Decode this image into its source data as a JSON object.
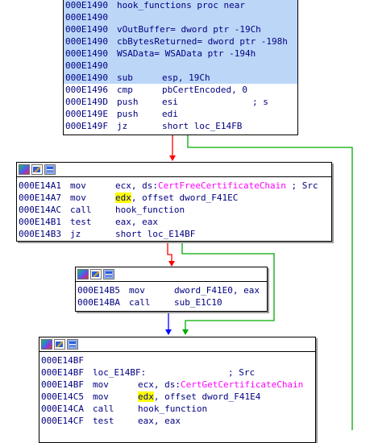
{
  "colors": {
    "edge_false": "#ff0000",
    "edge_true": "#00aa00",
    "edge_uncond": "#0000ff",
    "selection": "#bcd6f8",
    "text": "#000080",
    "api_name": "#ff00ff",
    "register_highlight": "#ffff00"
  },
  "block1": {
    "lines": [
      {
        "addr": "000E1490",
        "mn": "hook_functions proc near",
        "op": "",
        "cm": ""
      },
      {
        "addr": "000E1490",
        "mn": "",
        "op": "",
        "cm": ""
      },
      {
        "addr": "000E1490",
        "mn": "vOutBuffer= dword ptr -19Ch",
        "op": "",
        "cm": ""
      },
      {
        "addr": "000E1490",
        "mn": "cbBytesReturned= dword ptr -198h",
        "op": "",
        "cm": ""
      },
      {
        "addr": "000E1490",
        "mn": "WSAData= WSAData ptr -194h",
        "op": "",
        "cm": ""
      },
      {
        "addr": "000E1490",
        "mn": "",
        "op": "",
        "cm": ""
      },
      {
        "addr": "000E1490",
        "mn": "sub",
        "op": "esp, 19Ch",
        "cm": ""
      },
      {
        "addr": "000E1496",
        "mn": "cmp",
        "op": "pbCertEncoded, 0",
        "cm": ""
      },
      {
        "addr": "000E149D",
        "mn": "push",
        "op": "esi",
        "cm": "; s"
      },
      {
        "addr": "000E149E",
        "mn": "push",
        "op": "edi",
        "cm": ""
      },
      {
        "addr": "000E149F",
        "mn": "jz",
        "op": "short loc_E14FB",
        "cm": ""
      }
    ]
  },
  "block2": {
    "lines": [
      {
        "addr": "000E14A1",
        "mn": "mov",
        "op_pre": "ecx, ds:",
        "api": "CertFreeCertificateChain",
        "cm": " ; Src"
      },
      {
        "addr": "000E14A7",
        "mn": "mov",
        "reg": "edx",
        "op": ", offset dword_F41EC"
      },
      {
        "addr": "000E14AC",
        "mn": "call",
        "op": "hook_function"
      },
      {
        "addr": "000E14B1",
        "mn": "test",
        "op": "eax, eax"
      },
      {
        "addr": "000E14B3",
        "mn": "jz",
        "op": "short loc_E14BF"
      }
    ]
  },
  "block3": {
    "lines": [
      {
        "addr": "000E14B5",
        "mn": "mov",
        "op": "dword_F41E0, eax"
      },
      {
        "addr": "000E14BA",
        "mn": "call",
        "op": "sub_E1C10"
      }
    ]
  },
  "block4": {
    "lines": [
      {
        "addr": "000E14BF",
        "mn": "",
        "op": "",
        "cm": ""
      },
      {
        "addr": "000E14BF",
        "mn": "loc_E14BF:",
        "op": "",
        "cm": "; Src"
      },
      {
        "addr": "000E14BF",
        "mn": "mov",
        "op_pre": "ecx, ds:",
        "api": "CertGetCertificateChain",
        "cm": ""
      },
      {
        "addr": "000E14C5",
        "mn": "mov",
        "reg": "edx",
        "op": ", offset dword_F41E4"
      },
      {
        "addr": "000E14CA",
        "mn": "call",
        "op": "hook_function"
      },
      {
        "addr": "000E14CF",
        "mn": "test",
        "op": "eax, eax"
      }
    ]
  }
}
